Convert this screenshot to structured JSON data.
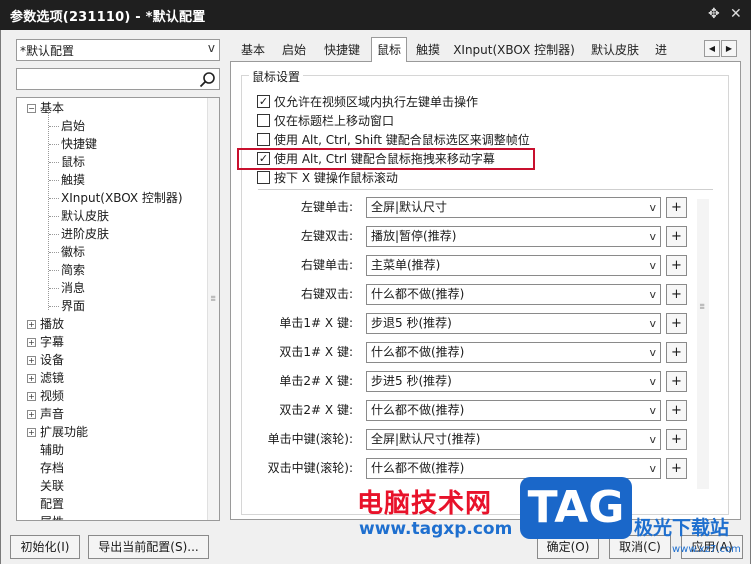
{
  "window": {
    "title": "参数选项(231110) - *默认配置",
    "pin_glyph": "✥",
    "close_glyph": "✕"
  },
  "sidebar": {
    "profile": "*默认配置",
    "tree": [
      {
        "label": "基本",
        "expander": "−",
        "level": 0
      },
      {
        "label": "启始",
        "level": 1
      },
      {
        "label": "快捷键",
        "level": 1
      },
      {
        "label": "鼠标",
        "level": 1
      },
      {
        "label": "触摸",
        "level": 1
      },
      {
        "label": "XInput(XBOX 控制器)",
        "level": 1
      },
      {
        "label": "默认皮肤",
        "level": 1
      },
      {
        "label": "进阶皮肤",
        "level": 1
      },
      {
        "label": "徽标",
        "level": 1
      },
      {
        "label": "简索",
        "level": 1
      },
      {
        "label": "消息",
        "level": 1
      },
      {
        "label": "界面",
        "level": 1
      },
      {
        "label": "播放",
        "expander": "+",
        "level": 0
      },
      {
        "label": "字幕",
        "expander": "+",
        "level": 0
      },
      {
        "label": "设备",
        "expander": "+",
        "level": 0
      },
      {
        "label": "滤镜",
        "expander": "+",
        "level": 0
      },
      {
        "label": "视频",
        "expander": "+",
        "level": 0
      },
      {
        "label": "声音",
        "expander": "+",
        "level": 0
      },
      {
        "label": "扩展功能",
        "expander": "+",
        "level": 0
      },
      {
        "label": "辅助",
        "level": 0
      },
      {
        "label": "存档",
        "level": 0
      },
      {
        "label": "关联",
        "level": 0
      },
      {
        "label": "配置",
        "level": 0
      },
      {
        "label": "属性",
        "level": 0
      }
    ]
  },
  "tabs": [
    {
      "label": "基本"
    },
    {
      "label": "启始"
    },
    {
      "label": "快捷键"
    },
    {
      "label": "鼠标",
      "active": true
    },
    {
      "label": "触摸"
    },
    {
      "label": "XInput(XBOX 控制器)"
    },
    {
      "label": "默认皮肤"
    },
    {
      "label": "进"
    }
  ],
  "tab_nav": {
    "prev": "◀",
    "next": "▶"
  },
  "mouse": {
    "group_title": "鼠标设置",
    "options": [
      {
        "label": "仅允许在视频区域内执行左键单击操作",
        "checked": true
      },
      {
        "label": "仅在标题栏上移动窗口",
        "checked": false
      },
      {
        "label": "使用 Alt, Ctrl, Shift 键配合鼠标选区来调整帧位",
        "checked": false
      },
      {
        "label": "使用 Alt, Ctrl 键配合鼠标拖拽来移动字幕",
        "checked": true
      },
      {
        "label": "按下 X 键操作鼠标滚动",
        "checked": false
      }
    ],
    "mappings": [
      {
        "label": "左键单击:",
        "value": "全屏|默认尺寸"
      },
      {
        "label": "左键双击:",
        "value": "播放|暂停(推荐)"
      },
      {
        "label": "右键单击:",
        "value": "主菜单(推荐)"
      },
      {
        "label": "右键双击:",
        "value": "什么都不做(推荐)"
      },
      {
        "label": "单击1# X 键:",
        "value": "步退5 秒(推荐)"
      },
      {
        "label": "双击1# X 键:",
        "value": "什么都不做(推荐)"
      },
      {
        "label": "单击2# X 键:",
        "value": "步进5 秒(推荐)"
      },
      {
        "label": "双击2# X 键:",
        "value": "什么都不做(推荐)"
      },
      {
        "label": "单击中键(滚轮):",
        "value": "全屏|默认尺寸(推荐)"
      },
      {
        "label": "双击中键(滚轮):",
        "value": "什么都不做(推荐)"
      }
    ],
    "plus_label": "+"
  },
  "buttons": {
    "init": "初始化(I)",
    "export": "导出当前配置(S)...",
    "ok": "确定(O)",
    "cancel": "取消(C)",
    "apply": "应用(A)"
  },
  "watermark": {
    "cn": "电脑技术网",
    "url": "www.tagxp.com",
    "tag": "TAG",
    "site": "极光下载站",
    "site_url": "www.xz7.com"
  },
  "colors": {
    "highlight": "#c8102e",
    "watermark_red": "#e8122a",
    "watermark_blue": "#1a67c9",
    "titlebar": "#1f1f1f"
  }
}
